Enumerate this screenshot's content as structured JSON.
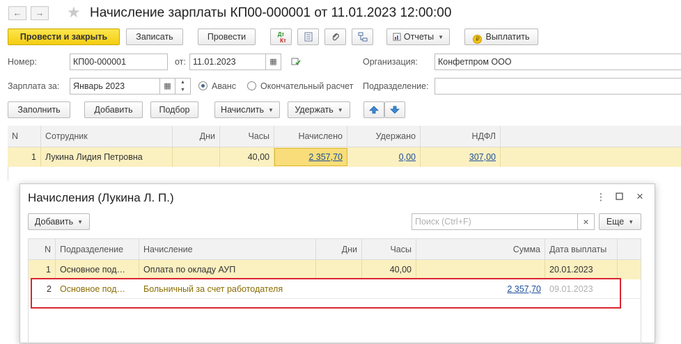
{
  "header": {
    "title": "Начисление зарплаты КП00-000001 от 11.01.2023 12:00:00",
    "back_glyph": "←",
    "forward_glyph": "→",
    "favorite_glyph": "★"
  },
  "toolbar": {
    "post_close": "Провести и закрыть",
    "write": "Записать",
    "post": "Провести",
    "dtkt_top": "Дт",
    "dtkt_bottom": "Кт",
    "reports": "Отчеты",
    "pay": "Выплатить"
  },
  "form": {
    "number_label": "Номер:",
    "number_value": "КП00-000001",
    "date_label": "от:",
    "date_value": "11.01.2023",
    "org_label": "Организация:",
    "org_value": "Конфетпром ООО",
    "salary_label": "Зарплата за:",
    "salary_value": "Январь 2023",
    "advance_label": "Аванс",
    "final_label": "Окончательный расчет",
    "advance_selected": true,
    "dept_label": "Подразделение:",
    "dept_value": ""
  },
  "table_toolbar": {
    "fill": "Заполнить",
    "add": "Добавить",
    "pick": "Подбор",
    "accrue": "Начислить",
    "deduct": "Удержать"
  },
  "main_table": {
    "headers": [
      "N",
      "Сотрудник",
      "Дни",
      "Часы",
      "Начислено",
      "Удержано",
      "НДФЛ"
    ],
    "rows": [
      {
        "n": "1",
        "employee": "Лукина Лидия Петровна",
        "days": "",
        "hours": "40,00",
        "accrued": "2 357,70",
        "withheld": "0,00",
        "ndfl": "307,00"
      }
    ]
  },
  "subwindow": {
    "title": "Начисления (Лукина Л. П.)",
    "add": "Добавить",
    "search_placeholder": "Поиск (Ctrl+F)",
    "search_clear": "×",
    "more": "Еще",
    "headers": [
      "N",
      "Подразделение",
      "Начисление",
      "Дни",
      "Часы",
      "Сумма",
      "Дата выплаты"
    ],
    "rows": [
      {
        "n": "1",
        "dept": "Основное под…",
        "accrual": "Оплата по окладу АУП",
        "days": "",
        "hours": "40,00",
        "sum": "",
        "date": "20.01.2023"
      },
      {
        "n": "2",
        "dept": "Основное под…",
        "accrual": "Больничный за счет работодателя",
        "days": "",
        "hours": "",
        "sum": "2 357,70",
        "date": "09.01.2023"
      }
    ]
  },
  "colors": {
    "accent_yellow": "#f4cd12",
    "selected_row": "#fbf0c0",
    "row2_text": "#8a6d00",
    "link": "#1c4e9c",
    "highlight_box": "#d9262f"
  }
}
